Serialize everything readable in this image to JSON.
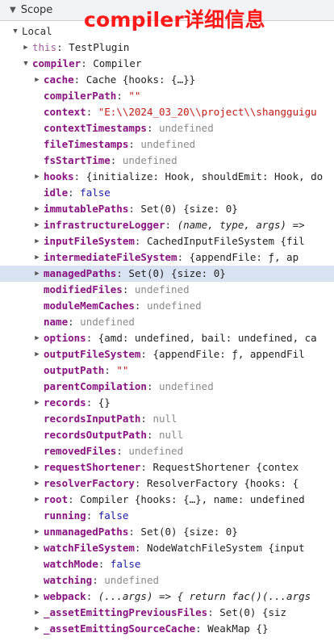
{
  "header": {
    "label": "Scope",
    "collapsed": false
  },
  "annotation": {
    "text": "compiler详细信息",
    "color": "#ff1a1a"
  },
  "rows": [
    {
      "depth": 0,
      "caret": "open",
      "key": "Local",
      "value": "",
      "kind": "section"
    },
    {
      "depth": 1,
      "caret": "closed",
      "key": "this",
      "value": "TestPlugin",
      "kind": "dimkey"
    },
    {
      "depth": 1,
      "caret": "open",
      "key": "compiler",
      "value": "Compiler",
      "kind": "obj"
    },
    {
      "depth": 2,
      "caret": "closed",
      "key": "cache",
      "value": "Cache  {hooks: {…}}",
      "kind": "obj"
    },
    {
      "depth": 2,
      "caret": "none",
      "key": "compilerPath",
      "value": "\"\"",
      "kind": "str"
    },
    {
      "depth": 2,
      "caret": "none",
      "key": "context",
      "value": "\"E:\\\\2024_03_20\\\\project\\\\shangguigu",
      "kind": "str"
    },
    {
      "depth": 2,
      "caret": "none",
      "key": "contextTimestamps",
      "value": "undefined",
      "kind": "undef"
    },
    {
      "depth": 2,
      "caret": "none",
      "key": "fileTimestamps",
      "value": "undefined",
      "kind": "undef"
    },
    {
      "depth": 2,
      "caret": "none",
      "key": "fsStartTime",
      "value": "undefined",
      "kind": "undef"
    },
    {
      "depth": 2,
      "caret": "closed",
      "key": "hooks",
      "value": "{initialize: Hook, shouldEmit: Hook, do",
      "kind": "obj"
    },
    {
      "depth": 2,
      "caret": "none",
      "key": "idle",
      "value": "false",
      "kind": "bool"
    },
    {
      "depth": 2,
      "caret": "closed",
      "key": "immutablePaths",
      "value": "Set(0)  {size: 0}",
      "kind": "obj"
    },
    {
      "depth": 2,
      "caret": "closed",
      "key": "infrastructureLogger",
      "value": "(name, type, args) =>",
      "kind": "fn"
    },
    {
      "depth": 2,
      "caret": "closed",
      "key": "inputFileSystem",
      "value": "CachedInputFileSystem  {fil",
      "kind": "obj"
    },
    {
      "depth": 2,
      "caret": "closed",
      "key": "intermediateFileSystem",
      "value": "{appendFile: ƒ, ap",
      "kind": "obj"
    },
    {
      "depth": 2,
      "caret": "closed",
      "key": "managedPaths",
      "value": "Set(0)  {size: 0}",
      "kind": "obj",
      "selected": true
    },
    {
      "depth": 2,
      "caret": "none",
      "key": "modifiedFiles",
      "value": "undefined",
      "kind": "undef"
    },
    {
      "depth": 2,
      "caret": "none",
      "key": "moduleMemCaches",
      "value": "undefined",
      "kind": "undef"
    },
    {
      "depth": 2,
      "caret": "none",
      "key": "name",
      "value": "undefined",
      "kind": "undef"
    },
    {
      "depth": 2,
      "caret": "closed",
      "key": "options",
      "value": "{amd: undefined, bail: undefined, ca",
      "kind": "obj"
    },
    {
      "depth": 2,
      "caret": "closed",
      "key": "outputFileSystem",
      "value": "{appendFile: ƒ, appendFil",
      "kind": "obj"
    },
    {
      "depth": 2,
      "caret": "none",
      "key": "outputPath",
      "value": "\"\"",
      "kind": "str"
    },
    {
      "depth": 2,
      "caret": "none",
      "key": "parentCompilation",
      "value": "undefined",
      "kind": "undef"
    },
    {
      "depth": 2,
      "caret": "closed",
      "key": "records",
      "value": "{}",
      "kind": "obj"
    },
    {
      "depth": 2,
      "caret": "none",
      "key": "recordsInputPath",
      "value": "null",
      "kind": "undef"
    },
    {
      "depth": 2,
      "caret": "none",
      "key": "recordsOutputPath",
      "value": "null",
      "kind": "undef"
    },
    {
      "depth": 2,
      "caret": "none",
      "key": "removedFiles",
      "value": "undefined",
      "kind": "undef"
    },
    {
      "depth": 2,
      "caret": "closed",
      "key": "requestShortener",
      "value": "RequestShortener  {contex",
      "kind": "obj"
    },
    {
      "depth": 2,
      "caret": "closed",
      "key": "resolverFactory",
      "value": "ResolverFactory  {hooks: {",
      "kind": "obj"
    },
    {
      "depth": 2,
      "caret": "closed",
      "key": "root",
      "value": "Compiler  {hooks: {…}, name: undefined",
      "kind": "obj"
    },
    {
      "depth": 2,
      "caret": "none",
      "key": "running",
      "value": "false",
      "kind": "bool"
    },
    {
      "depth": 2,
      "caret": "closed",
      "key": "unmanagedPaths",
      "value": "Set(0)  {size: 0}",
      "kind": "obj"
    },
    {
      "depth": 2,
      "caret": "closed",
      "key": "watchFileSystem",
      "value": "NodeWatchFileSystem  {input",
      "kind": "obj"
    },
    {
      "depth": 2,
      "caret": "none",
      "key": "watchMode",
      "value": "false",
      "kind": "bool"
    },
    {
      "depth": 2,
      "caret": "none",
      "key": "watching",
      "value": "undefined",
      "kind": "undef"
    },
    {
      "depth": 2,
      "caret": "closed",
      "key": "webpack",
      "value": "(...args) => { return fac()(...args",
      "kind": "fn"
    },
    {
      "depth": 2,
      "caret": "closed",
      "key": "_assetEmittingPreviousFiles",
      "value": "Set(0)  {siz",
      "kind": "obj"
    },
    {
      "depth": 2,
      "caret": "closed",
      "key": "_assetEmittingSourceCache",
      "value": "WeakMap  {}",
      "kind": "obj"
    }
  ],
  "icons": {
    "expanded": "triangle-down",
    "collapsed": "triangle-right"
  }
}
